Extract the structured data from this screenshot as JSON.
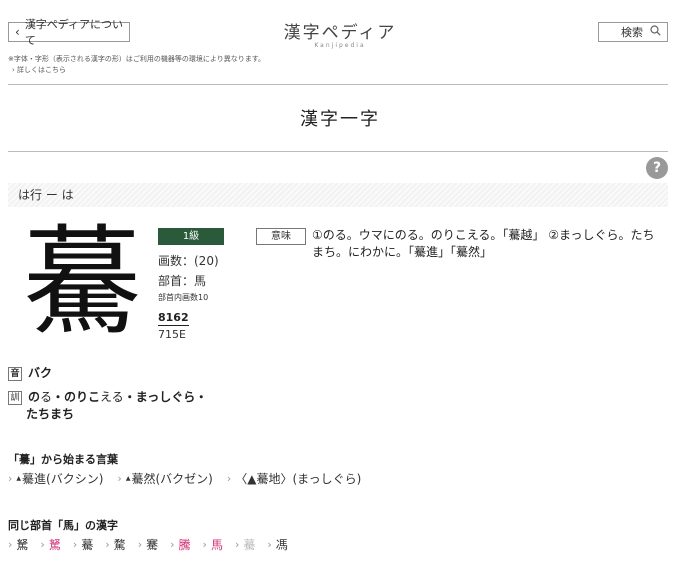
{
  "header": {
    "about_label": "漢字ペディアについて",
    "logo_title": "漢字ペディア",
    "logo_sub": "Kanjipedia",
    "search_label": "検索"
  },
  "notice": {
    "line1": "※字体・字形（表示される漢字の形）はご利用の機器等の環境により異なります。",
    "line2": "詳しくはこちら"
  },
  "page_title": "漢字一字",
  "help_label": "?",
  "row_label": "は行 ー は",
  "kanji": {
    "char": "驀",
    "grade": "1級",
    "strokes": "画数：(20)",
    "radical": "部首：馬",
    "radical_strokes": "部首内画数10",
    "code_a": "8162",
    "code_b": "715E"
  },
  "meaning": {
    "tag": "意味",
    "text": "①のる。ウマにのる。のりこえる。「驀越」 ②まっしぐら。たちまち。にわかに。「驀進」「驀然」"
  },
  "readings": {
    "on_tag": "音",
    "on": "バク",
    "kun_tag": "訓",
    "kun": [
      {
        "k": "の",
        "o": "る"
      },
      {
        "k": "・のりこ",
        "o": "える"
      },
      {
        "k": "・まっしぐら・",
        "o": ""
      },
      {
        "k": "たちまち",
        "o": ""
      }
    ]
  },
  "words": {
    "title": "「驀」から始まる言葉",
    "items": [
      "驀進(バクシン)",
      "驀然(バクゼン)",
      "〈▲驀地〉(まっしぐら)"
    ]
  },
  "same_radical": {
    "title": "同じ部首「馬」の漢字",
    "items": [
      {
        "c": "駑",
        "style": "normal"
      },
      {
        "c": "駑",
        "style": "pink"
      },
      {
        "c": "驀",
        "style": "normal"
      },
      {
        "c": "騖",
        "style": "normal"
      },
      {
        "c": "騫",
        "style": "normal"
      },
      {
        "c": "騰",
        "style": "pink"
      },
      {
        "c": "馬",
        "style": "pink"
      },
      {
        "c": "驀",
        "style": "grey"
      },
      {
        "c": "馮",
        "style": "normal"
      }
    ]
  }
}
